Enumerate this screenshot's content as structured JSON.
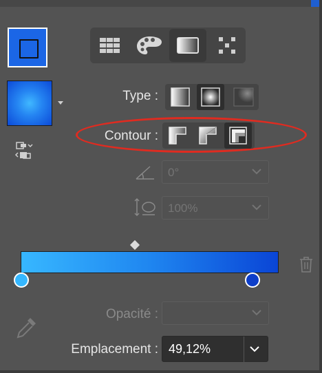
{
  "panel": {
    "mode_buttons": [
      {
        "icon": "swatches-grid-icon",
        "active": false
      },
      {
        "icon": "palette-icon",
        "active": false
      },
      {
        "icon": "gradient-mode-icon",
        "active": true
      },
      {
        "icon": "pattern-icon",
        "active": false
      }
    ],
    "type": {
      "label": "Type :",
      "options": [
        "linear-gradient-icon",
        "radial-gradient-icon",
        "freeform-gradient-icon"
      ],
      "selected": 1
    },
    "contour": {
      "label": "Contour :",
      "options": [
        "stroke-within-icon",
        "stroke-along-icon",
        "stroke-across-icon"
      ],
      "selected": 2
    },
    "angle": {
      "value": "0°",
      "icon": "angle-icon"
    },
    "aspect": {
      "value": "100%",
      "icon": "aspect-ratio-icon"
    },
    "opacity": {
      "label": "Opacité :",
      "value": ""
    },
    "location": {
      "label": "Emplacement :",
      "value": "49,12%"
    }
  },
  "gradient": {
    "stops": [
      {
        "position": 0,
        "color": "#35b7ff"
      },
      {
        "position": 100,
        "color": "#0d3ec9"
      }
    ],
    "midpoint": 45
  },
  "colors": {
    "panel_bg": "#535353",
    "highlight": "#e02b20",
    "fill_blue": "#1b66e6"
  }
}
